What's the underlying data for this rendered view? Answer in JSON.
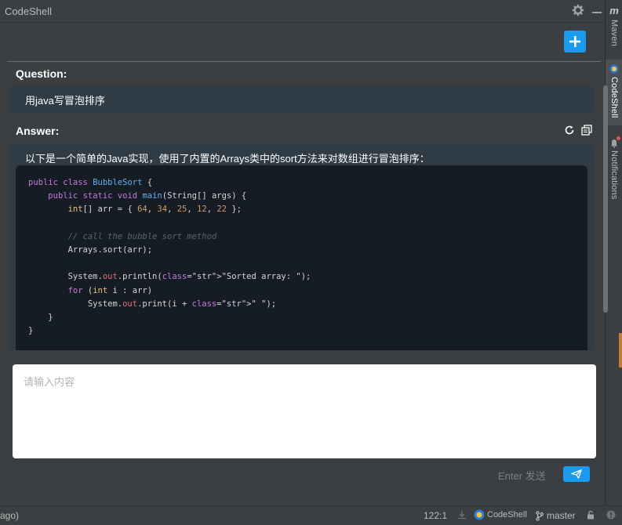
{
  "window": {
    "title": "CodeShell"
  },
  "toolwindows": {
    "maven": {
      "label": "Maven"
    },
    "codeshell": {
      "label": "CodeShell"
    },
    "notifications": {
      "label": "Notifications"
    }
  },
  "chat": {
    "question_label": "Question:",
    "question_text": "用java写冒泡排序",
    "answer_label": "Answer:",
    "answer_intro": "以下是一个简单的Java实现，使用了内置的Arrays类中的sort方法来对数组进行冒泡排序：",
    "code_lines": [
      "public class BubbleSort {",
      "    public static void main(String[] args) {",
      "        int[] arr = { 64, 34, 25, 12, 22 };",
      "",
      "        // call the bubble sort method",
      "        Arrays.sort(arr);",
      "",
      "        System.out.println(\"Sorted array: \");",
      "        for (int i : arr)",
      "            System.out.print(i + \" \");",
      "    }",
      "}"
    ]
  },
  "input": {
    "placeholder": "请输入内容",
    "value": "",
    "send_hint": "Enter 发送"
  },
  "statusbar": {
    "left_text": "ago)",
    "position": "122:1",
    "plugin": "CodeShell",
    "branch": "master"
  },
  "colors": {
    "accent": "#1a9bf0",
    "panel": "#3c3f41",
    "code_bg": "#161c24",
    "bubble_bg": "#2f3b45"
  }
}
